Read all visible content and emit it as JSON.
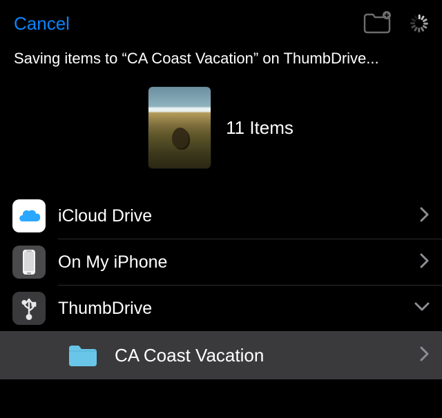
{
  "nav": {
    "cancel": "Cancel"
  },
  "status": "Saving items to “CA Coast Vacation” on ThumbDrive...",
  "item_count": "11 Items",
  "locations": [
    {
      "label": "iCloud Drive"
    },
    {
      "label": "On My iPhone"
    },
    {
      "label": "ThumbDrive"
    }
  ],
  "subfolder": {
    "label": "CA Coast Vacation"
  }
}
